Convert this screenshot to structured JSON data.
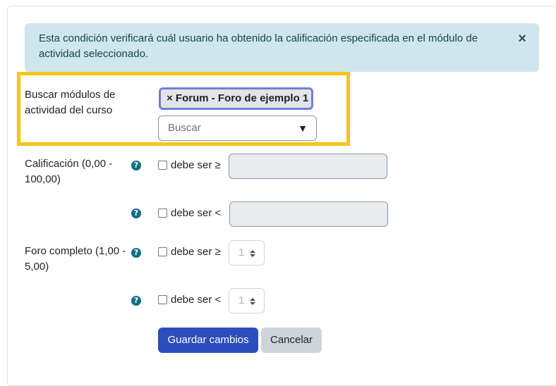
{
  "alert": {
    "text": "Esta condición verificará cuál usuario ha obtenido la calificación especificada en el módulo de actividad seleccionado.",
    "close": "×"
  },
  "module_search": {
    "label_line1": "Buscar módulos de",
    "label_line2": "actividad del curso",
    "selected_tag": "× Forum - Foro de ejemplo 1",
    "search_placeholder": "Buscar",
    "dropdown_arrow": "▼"
  },
  "grade": {
    "label_line1": "Calificación (0,00 -",
    "label_line2": "100,00)",
    "min_check": "debe ser ≥",
    "max_check": "debe ser <"
  },
  "forum": {
    "label_line1": "Foro completo (1,00 -",
    "label_line2": "5,00)",
    "min_check": "debe ser ≥",
    "max_check": "debe ser <",
    "min_value": "1",
    "max_value": "1"
  },
  "help_glyph": "?",
  "buttons": {
    "save": "Guardar cambios",
    "cancel": "Cancelar"
  }
}
